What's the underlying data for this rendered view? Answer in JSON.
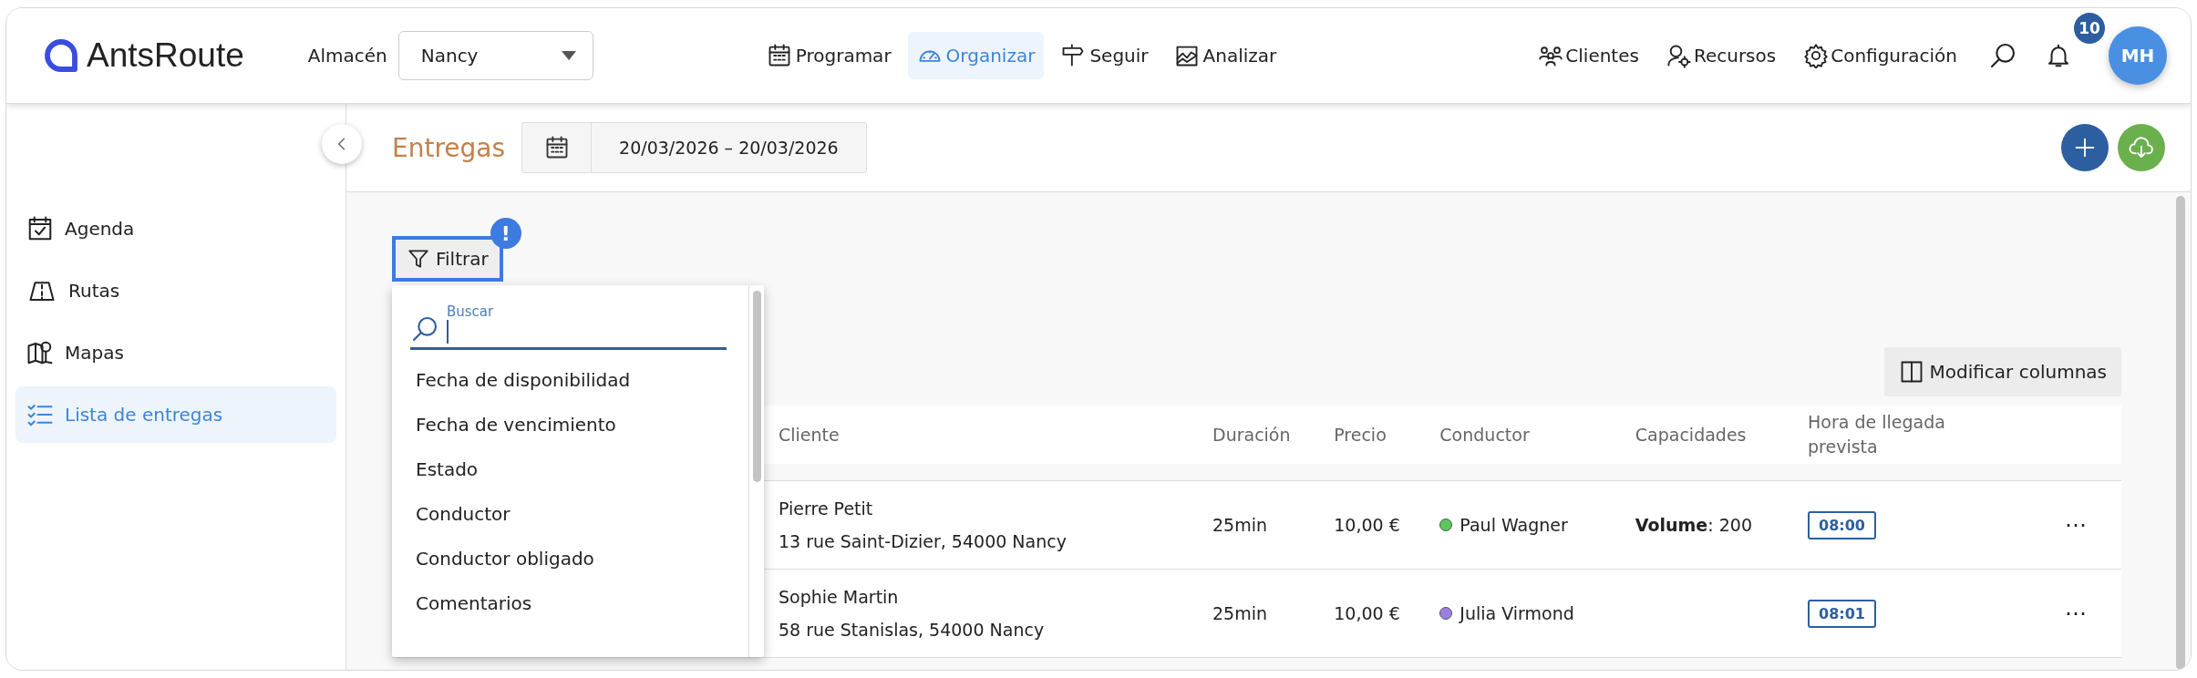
{
  "header": {
    "logo": "AntsRoute",
    "warehouse_label": "Almacén",
    "warehouse": "Nancy",
    "nav": [
      {
        "label": "Programar",
        "selected": false
      },
      {
        "label": "Organizar",
        "selected": true
      },
      {
        "label": "Seguir",
        "selected": false
      },
      {
        "label": "Analizar",
        "selected": false
      }
    ],
    "tools": [
      "Clientes",
      "Recursos",
      "Configuración"
    ],
    "notifications_badge": "10",
    "avatar": "MH"
  },
  "sidebar": {
    "items": [
      {
        "label": "Agenda",
        "selected": false
      },
      {
        "label": "Rutas",
        "selected": false
      },
      {
        "label": "Mapas",
        "selected": false
      },
      {
        "label": "Lista de entregas",
        "selected": true
      }
    ]
  },
  "page": {
    "title": "Entregas",
    "date_range": "20/03/2026 – 20/03/2026"
  },
  "filter": {
    "label": "Filtrar",
    "alert": "!",
    "search_label": "Buscar",
    "options": [
      "Fecha de disponibilidad",
      "Fecha de vencimiento",
      "Estado",
      "Conductor",
      "Conductor obligado",
      "Comentarios"
    ]
  },
  "columns_button": "Modificar columnas",
  "table": {
    "columns": [
      "Cliente",
      "Duración",
      "Precio",
      "Conductor",
      "Capacidades",
      "Hora de llegada prevista"
    ],
    "rows": [
      {
        "name": "Pierre Petit",
        "address": "13 rue Saint-Dizier, 54000 Nancy",
        "duration": "25min",
        "price": "10,00 €",
        "driver": "Paul Wagner",
        "color": "#5cc85c",
        "capacity": "**Volume**: 200",
        "eta": "08:00",
        "menu": "⋯"
      },
      {
        "name": "Sophie Martin",
        "address": "58 rue Stanislas, 54000 Nancy",
        "duration": "25min",
        "price": "10,00 €",
        "driver": "Julia Virmond",
        "color": "#9b7fe0",
        "capacity": "",
        "eta": "08:01",
        "menu": "⋯"
      }
    ]
  }
}
